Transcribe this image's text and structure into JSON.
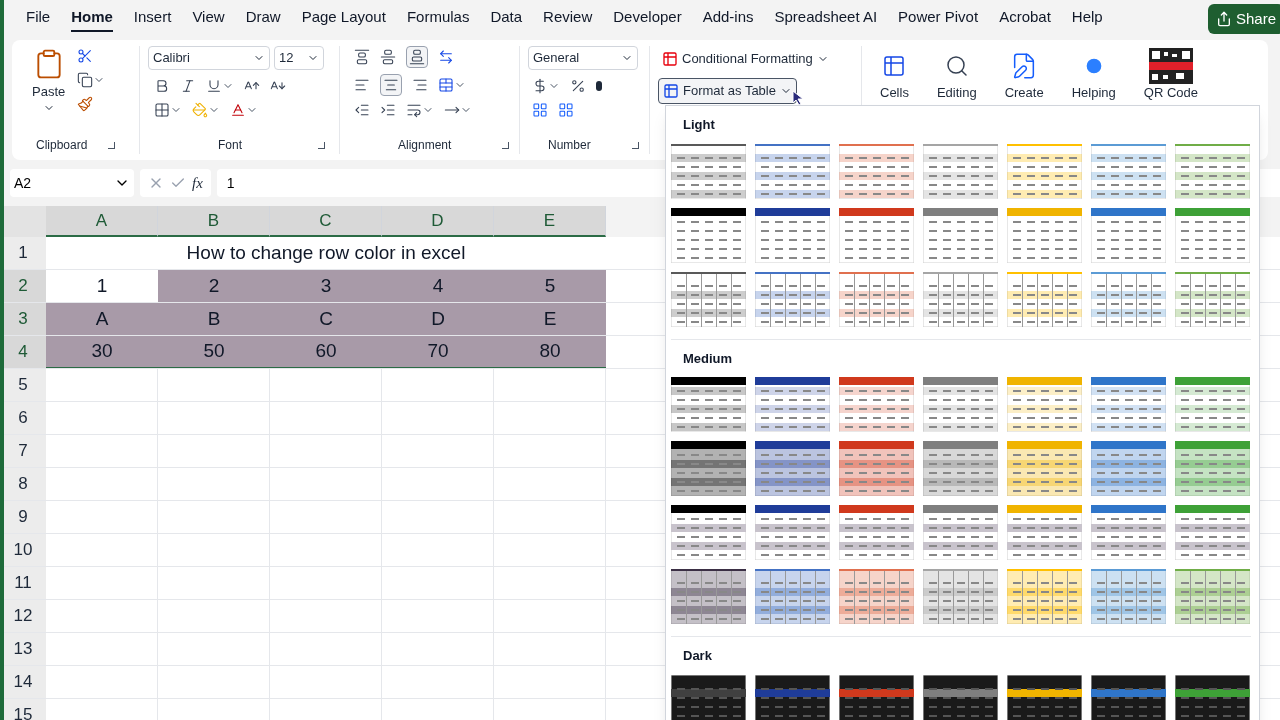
{
  "menu_tabs": [
    {
      "label": "File",
      "selected": false
    },
    {
      "label": "Home",
      "selected": true
    },
    {
      "label": "Insert",
      "selected": false
    },
    {
      "label": "View",
      "selected": false
    },
    {
      "label": "Draw",
      "selected": false
    },
    {
      "label": "Page Layout",
      "selected": false
    },
    {
      "label": "Formulas",
      "selected": false
    },
    {
      "label": "Data",
      "selected": false
    },
    {
      "label": "Review",
      "selected": false
    },
    {
      "label": "Developer",
      "selected": false
    },
    {
      "label": "Add-ins",
      "selected": false
    },
    {
      "label": "Spreadsheet AI",
      "selected": false
    },
    {
      "label": "Power Pivot",
      "selected": false
    },
    {
      "label": "Acrobat",
      "selected": false
    },
    {
      "label": "Help",
      "selected": false
    }
  ],
  "share_button": "Share",
  "ribbon": {
    "clipboard": {
      "paste": "Paste",
      "label": "Clipboard"
    },
    "font": {
      "name": "Calibri",
      "size": "12",
      "label": "Font"
    },
    "alignment": {
      "label": "Alignment"
    },
    "number": {
      "format": "General",
      "label": "Number"
    },
    "styles": {
      "conditional_formatting": "Conditional Formatting",
      "format_as_table": "Format as Table",
      "format_as_table_expanded": true
    },
    "buttons": [
      {
        "label": "Cells",
        "kind": "cells"
      },
      {
        "label": "Editing",
        "kind": "editing"
      },
      {
        "label": "Create",
        "kind": "create"
      },
      {
        "label": "Helping",
        "kind": "helping"
      },
      {
        "label": "QR Code",
        "kind": "qr"
      }
    ]
  },
  "formula_bar": {
    "name_box": "A2",
    "function_label": "fx",
    "formula": "1"
  },
  "sheet": {
    "columns": [
      "A",
      "B",
      "C",
      "D",
      "E"
    ],
    "rows": [
      {
        "number": "1",
        "kind": "title",
        "cells": [
          {
            "text": "How to change row color in excel"
          }
        ]
      },
      {
        "number": "2",
        "kind": "data",
        "cells": [
          {
            "text": "1",
            "selected": true
          },
          {
            "text": "2",
            "selected": false
          },
          {
            "text": "3",
            "selected": false
          },
          {
            "text": "4",
            "selected": false
          },
          {
            "text": "5",
            "selected": false
          }
        ]
      },
      {
        "number": "3",
        "kind": "data",
        "cells": [
          {
            "text": "A",
            "selected": false
          },
          {
            "text": "B",
            "selected": false
          },
          {
            "text": "C",
            "selected": false
          },
          {
            "text": "D",
            "selected": false
          },
          {
            "text": "E",
            "selected": false
          }
        ]
      },
      {
        "number": "4",
        "kind": "data",
        "cells": [
          {
            "text": "30",
            "selected": false
          },
          {
            "text": "50",
            "selected": false
          },
          {
            "text": "60",
            "selected": false
          },
          {
            "text": "70",
            "selected": false
          },
          {
            "text": "80",
            "selected": false
          }
        ]
      },
      {
        "number": "5",
        "kind": "empty"
      },
      {
        "number": "6",
        "kind": "empty"
      },
      {
        "number": "7",
        "kind": "empty"
      },
      {
        "number": "8",
        "kind": "empty"
      },
      {
        "number": "9",
        "kind": "empty"
      },
      {
        "number": "10",
        "kind": "empty"
      },
      {
        "number": "11",
        "kind": "empty"
      },
      {
        "number": "12",
        "kind": "empty"
      },
      {
        "number": "13",
        "kind": "empty"
      },
      {
        "number": "14",
        "kind": "empty"
      },
      {
        "number": "15",
        "kind": "empty"
      }
    ]
  },
  "table_styles": {
    "sections": [
      {
        "title": "Light",
        "rows": [
          {
            "kind": "lines",
            "swatches": [
              {
                "color": "#595959"
              },
              {
                "color": "#4472c4"
              },
              {
                "color": "#e0704f"
              },
              {
                "color": "#a5a5a5"
              },
              {
                "color": "#ffc000"
              },
              {
                "color": "#5b9bd5"
              },
              {
                "color": "#70ad47"
              }
            ]
          },
          {
            "kind": "header",
            "swatches": [
              {
                "color": "#000000"
              },
              {
                "color": "#1f3c99"
              },
              {
                "color": "#d0391d"
              },
              {
                "color": "#7f7f7f"
              },
              {
                "color": "#f0b400"
              },
              {
                "color": "#2f75c9"
              },
              {
                "color": "#3ea137"
              }
            ]
          },
          {
            "kind": "grid",
            "swatches": [
              {
                "color": "#595959"
              },
              {
                "color": "#4472c4"
              },
              {
                "color": "#e0704f"
              },
              {
                "color": "#a5a5a5"
              },
              {
                "color": "#ffc000"
              },
              {
                "color": "#5b9bd5"
              },
              {
                "color": "#70ad47"
              }
            ]
          }
        ]
      },
      {
        "title": "Medium",
        "rows": [
          {
            "kind": "banded",
            "swatches": [
              {
                "color": "#000000"
              },
              {
                "color": "#1f3c99"
              },
              {
                "color": "#d0391d"
              },
              {
                "color": "#7f7f7f"
              },
              {
                "color": "#f0b400"
              },
              {
                "color": "#2f75c9"
              },
              {
                "color": "#3ea137"
              }
            ]
          },
          {
            "kind": "full",
            "swatches": [
              {
                "color": "#000000"
              },
              {
                "color": "#1f3c99"
              },
              {
                "color": "#d0391d"
              },
              {
                "color": "#7f7f7f"
              },
              {
                "color": "#f0b400"
              },
              {
                "color": "#2f75c9"
              },
              {
                "color": "#3ea137"
              }
            ]
          },
          {
            "kind": "header-gray",
            "swatches": [
              {
                "color": "#000000"
              },
              {
                "color": "#1f3c99"
              },
              {
                "color": "#d0391d"
              },
              {
                "color": "#7f7f7f"
              },
              {
                "color": "#f0b400"
              },
              {
                "color": "#2f75c9"
              },
              {
                "color": "#3ea137"
              }
            ]
          },
          {
            "kind": "grid-full",
            "swatches": [
              {
                "color": "#3b2f45"
              },
              {
                "color": "#4472c4"
              },
              {
                "color": "#e0704f"
              },
              {
                "color": "#a5a5a5"
              },
              {
                "color": "#ffc000"
              },
              {
                "color": "#5b9bd5"
              },
              {
                "color": "#70ad47"
              }
            ]
          }
        ]
      },
      {
        "title": "Dark",
        "rows": [
          {
            "kind": "dark",
            "swatches": [
              {
                "color": "#404040"
              },
              {
                "color": "#1f3c99"
              },
              {
                "color": "#d0391d"
              },
              {
                "color": "#7f7f7f"
              },
              {
                "color": "#f0b400"
              },
              {
                "color": "#2f75c9"
              },
              {
                "color": "#3ea137"
              }
            ]
          }
        ]
      }
    ]
  }
}
